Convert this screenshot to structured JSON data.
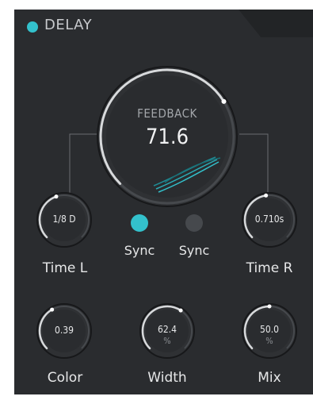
{
  "module": {
    "title": "DELAY",
    "accent": "#33c1cc",
    "panel_color": "#2a2c2f"
  },
  "feedback": {
    "label": "FEEDBACK",
    "value": "71.6",
    "level": 0.716
  },
  "time_l": {
    "label": "Time L",
    "value": "1/8 D",
    "level": 0.43
  },
  "time_r": {
    "label": "Time R",
    "value": "0.710s",
    "level": 0.47
  },
  "sync_l": {
    "label": "Sync",
    "on": true
  },
  "sync_r": {
    "label": "Sync",
    "on": false
  },
  "color": {
    "label": "Color",
    "value": "0.39",
    "level": 0.39
  },
  "width": {
    "label": "Width",
    "value": "62.4",
    "unit": "%",
    "level": 0.624
  },
  "mix": {
    "label": "Mix",
    "value": "50.0",
    "unit": "%",
    "level": 0.5
  }
}
